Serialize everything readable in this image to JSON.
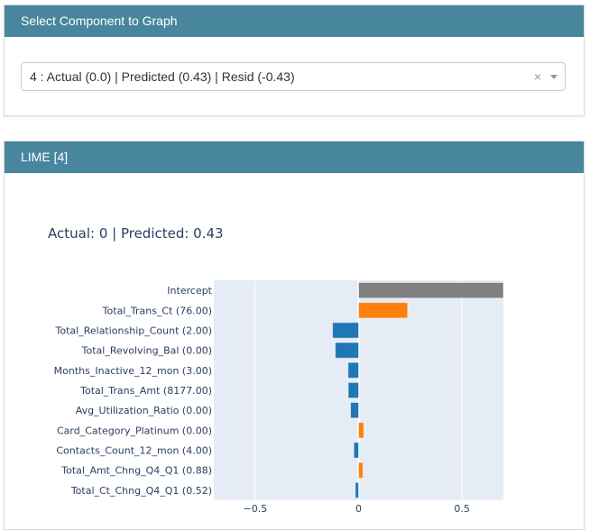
{
  "selector_panel": {
    "title": "Select Component to Graph",
    "selected_value": "4 : Actual (0.0) | Predicted (0.43) | Resid (-0.43)",
    "clear_icon": "×"
  },
  "lime_panel": {
    "title": "LIME [4]",
    "plot_title": "Actual: 0 | Predicted: 0.43"
  },
  "chart_data": {
    "type": "bar",
    "orientation": "horizontal",
    "title": "Actual: 0 | Predicted: 0.43",
    "categories": [
      "Intercept",
      "Total_Trans_Ct (76.00)",
      "Total_Relationship_Count (2.00)",
      "Total_Revolving_Bal (0.00)",
      "Months_Inactive_12_mon (3.00)",
      "Total_Trans_Amt (8177.00)",
      "Avg_Utilization_Ratio (0.00)",
      "Card_Category_Platinum (0.00)",
      "Contacts_Count_12_mon (4.00)",
      "Total_Amt_Chng_Q4_Q1 (0.88)",
      "Total_Ct_Chng_Q4_Q1 (0.52)"
    ],
    "values": [
      0.72,
      0.237,
      -0.126,
      -0.113,
      -0.051,
      -0.05,
      -0.039,
      0.025,
      -0.023,
      0.021,
      -0.016
    ],
    "colors": {
      "intercept": "#808080",
      "positive": "#ff7f0e",
      "negative": "#1f77b4"
    },
    "xlim": [
      -0.7,
      0.7
    ],
    "xticks": [
      -0.5,
      0,
      0.5
    ],
    "xtick_labels": [
      "−0.5",
      "0",
      "0.5"
    ],
    "plot_bg": "#e5ecf6",
    "grid": true
  }
}
